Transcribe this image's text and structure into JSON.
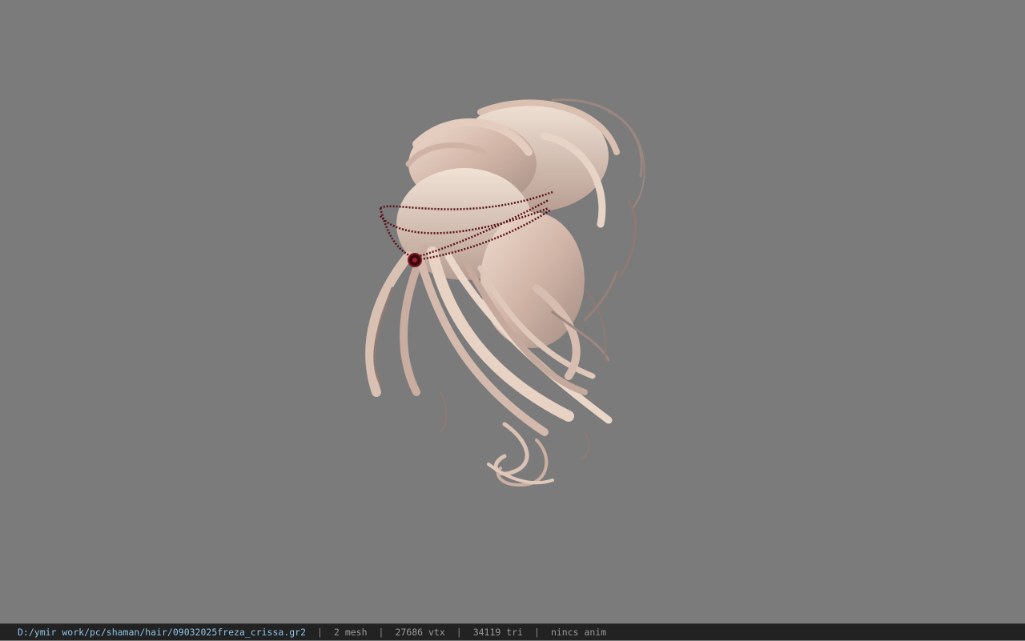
{
  "viewer": {
    "background_color": "#7b7b7b",
    "model_subject": "hair-mesh"
  },
  "statusbar": {
    "file_path": "D:/ymir work/pc/shaman/hair/09032025freza_crissa.gr2",
    "separator": "|",
    "mesh_count": "2 mesh",
    "vertex_count": "27686 vtx",
    "triangle_count": "34119 tri",
    "anim_status": "nincs anim"
  },
  "colors": {
    "hair_light": "#e8d3c4",
    "hair_mid": "#c9ada0",
    "hair_shadow": "#8f7a72",
    "accessory": "#5a1018",
    "path_text": "#8fc3e6",
    "status_text": "#9a9a9a"
  }
}
